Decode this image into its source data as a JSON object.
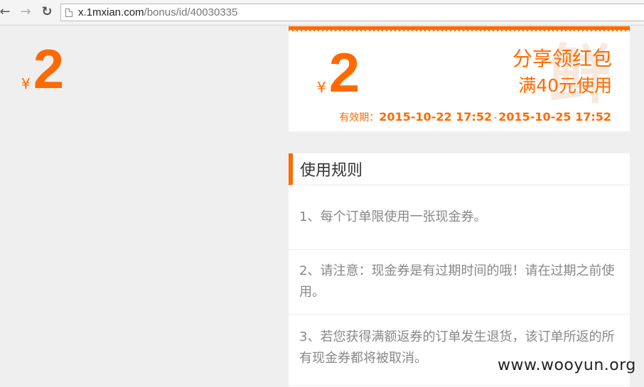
{
  "browser": {
    "back_icon": "back-arrow-icon",
    "forward_icon": "forward-arrow-icon",
    "reload_icon": "reload-icon",
    "url_host": "x.1mxian.com",
    "url_path": "/bonus/id/40030335"
  },
  "left_preview": {
    "currency": "¥",
    "amount": "2"
  },
  "coupon": {
    "currency": "¥",
    "amount": "2",
    "title": "分享领红包",
    "condition": "满40元使用",
    "validity_label": "有效期：",
    "valid_from": "2015-10-22 17:52",
    "separator": "-",
    "valid_to": "2015-10-25 17:52",
    "watermark": "鲜",
    "accent_color": "#ff6a00"
  },
  "rules": {
    "title": "使用规则",
    "items": [
      "1、每个订单限使用一张现金券。",
      "2、请注意：现金券是有过期时间的哦！请在过期之前使用。",
      "3、若您获得满额返券的订单发生退货，该订单所返的所有现金券都将被取消。"
    ]
  },
  "overlay_watermark": "www.wooyun.org"
}
